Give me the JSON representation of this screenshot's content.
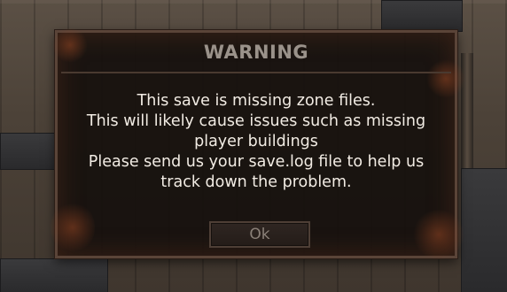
{
  "dialog": {
    "title": "WARNING",
    "message_lines": [
      "This save is missing zone files.",
      "This will likely cause issues such as missing",
      "player buildings",
      "Please send us your save.log file to help us",
      "track down the problem."
    ],
    "ok_label": "Ok"
  },
  "colors": {
    "title": "#9a928a",
    "message": "#f2ece4",
    "button_text": "#8a8078",
    "dialog_bg": "#16100d",
    "dialog_border": "#5a4438"
  }
}
